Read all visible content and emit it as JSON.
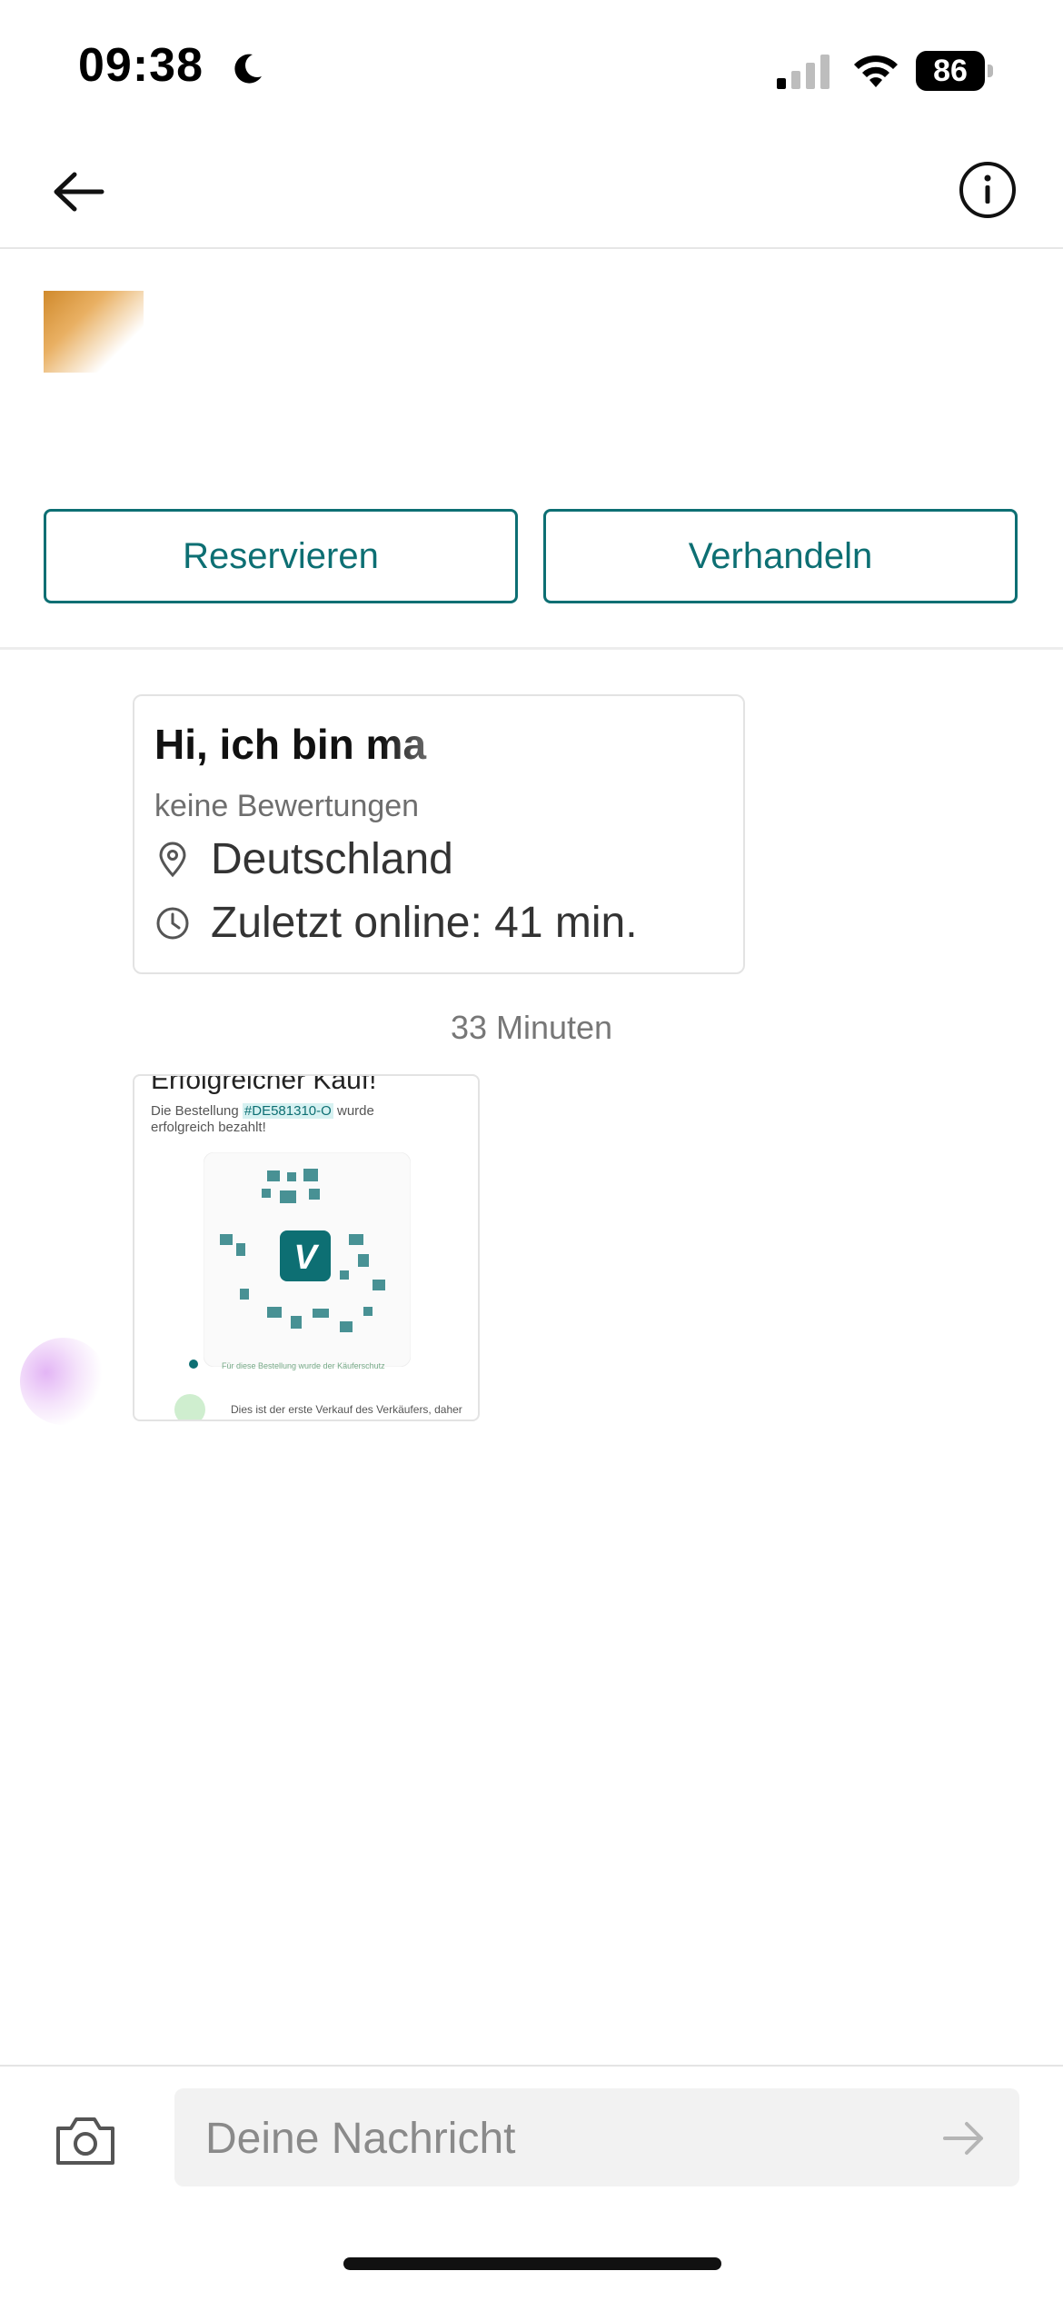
{
  "status_bar": {
    "time": "09:38",
    "battery": "86"
  },
  "header": {
    "title": ""
  },
  "item": {
    "price_line": "",
    "reserve_label": "Reservieren",
    "negotiate_label": "Verhandeln"
  },
  "profile": {
    "greeting": "Hi, ich bin ma",
    "rating": "keine Bewertungen",
    "location": "Deutschland",
    "last_online": "Zuletzt online: 41 min."
  },
  "chat": {
    "timestamp": "33 Minuten",
    "image_message": {
      "title": "Erfolgreicher Kauf!",
      "line1_prefix": "Die Bestellung ",
      "order_id": "#DE581310-O",
      "line1_suffix": " wurde",
      "line2": "erfolgreich bezahlt!",
      "note1": "Für diese Bestellung wurde der Käuferschutz",
      "note2": "Dies ist der erste Verkauf des Verkäufers, daher"
    }
  },
  "composer": {
    "placeholder": "Deine Nachricht"
  },
  "colors": {
    "accent": "#0d6f73",
    "divider": "#e6e6e6"
  }
}
